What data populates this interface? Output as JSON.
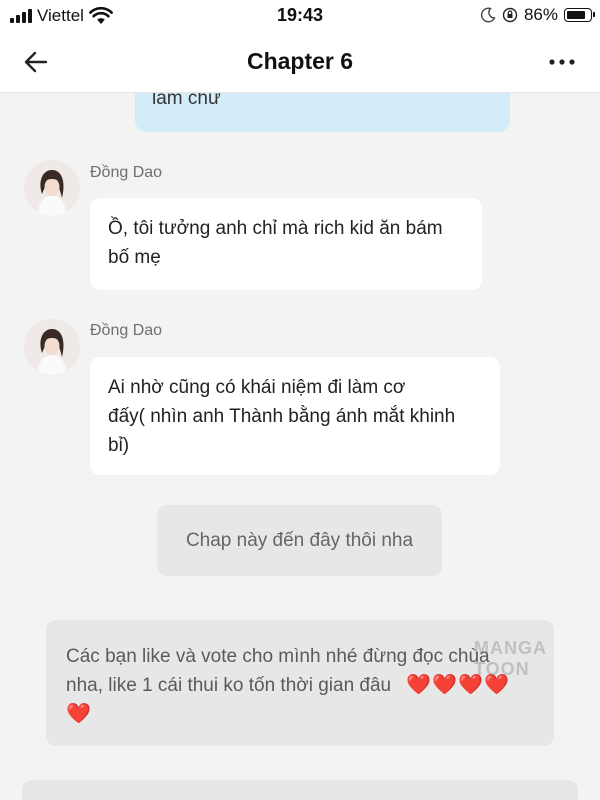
{
  "status_bar": {
    "carrier": "Viettel",
    "time": "19:43",
    "battery_percent": "86%",
    "icons": [
      "signal-icon",
      "wifi-icon",
      "moon-icon",
      "rotation-lock-icon",
      "battery-icon"
    ]
  },
  "nav": {
    "title": "Chapter 6",
    "back_icon": "arrow-left-icon",
    "more_icon": "more-icon"
  },
  "messages": [
    {
      "type": "self",
      "text": "làm chứ"
    },
    {
      "type": "character",
      "name": "Đồng Dao",
      "lines": [
        "Ồ, tôi tưởng anh chỉ mà rich kid ăn bám",
        "bố mẹ"
      ]
    },
    {
      "type": "character",
      "name": "Đồng Dao",
      "lines": [
        "Ai nhờ cũng có khái niệm đi làm cơ",
        "đấy( nhìn anh Thành bằng ánh mắt khinh",
        "bỉ)"
      ]
    },
    {
      "type": "narration",
      "text": "Chap này đến đây thôi nha"
    },
    {
      "type": "author_note",
      "lines": [
        "Các bạn like và vote cho mình nhé đừng đọc chùa",
        "nha, like 1 cái thui ko tốn thời gian đâu"
      ],
      "hearts_line2": "❤️❤️❤️❤️",
      "hearts_line3": "❤️"
    }
  ],
  "watermark": "MANGA TOON",
  "colors": {
    "background": "#f3f3f3",
    "self_bubble": "#d3ecfa",
    "character_bubble": "#ffffff",
    "narration_bubble": "#e7e7e7",
    "heart": "#e53935"
  }
}
